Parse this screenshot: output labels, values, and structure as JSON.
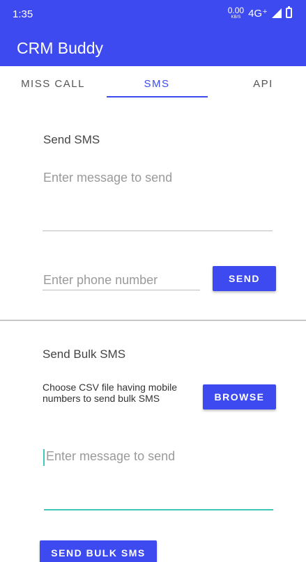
{
  "status_bar": {
    "time": "1:35",
    "net_speed_value": "0.00",
    "net_speed_unit": "KB/S",
    "network": "4G⁺",
    "icons": [
      "signal-icon",
      "battery-icon"
    ]
  },
  "app_bar": {
    "title": "CRM Buddy",
    "color": "#3d4af0"
  },
  "tabs": [
    {
      "label": "MISS CALL",
      "active": false
    },
    {
      "label": "SMS",
      "active": true
    },
    {
      "label": "API",
      "active": false
    }
  ],
  "send_sms": {
    "title": "Send SMS",
    "message_placeholder": "Enter message to send",
    "phone_placeholder": "Enter phone number",
    "send_label": "SEND"
  },
  "bulk_sms": {
    "title": "Send Bulk SMS",
    "hint": "Choose CSV file having mobile numbers to send bulk SMS",
    "browse_label": "BROWSE",
    "message_placeholder": "Enter message to send",
    "send_bulk_label": "SEND BULK SMS"
  },
  "colors": {
    "accent": "#3d4af0",
    "focus": "#3ec8b8"
  }
}
